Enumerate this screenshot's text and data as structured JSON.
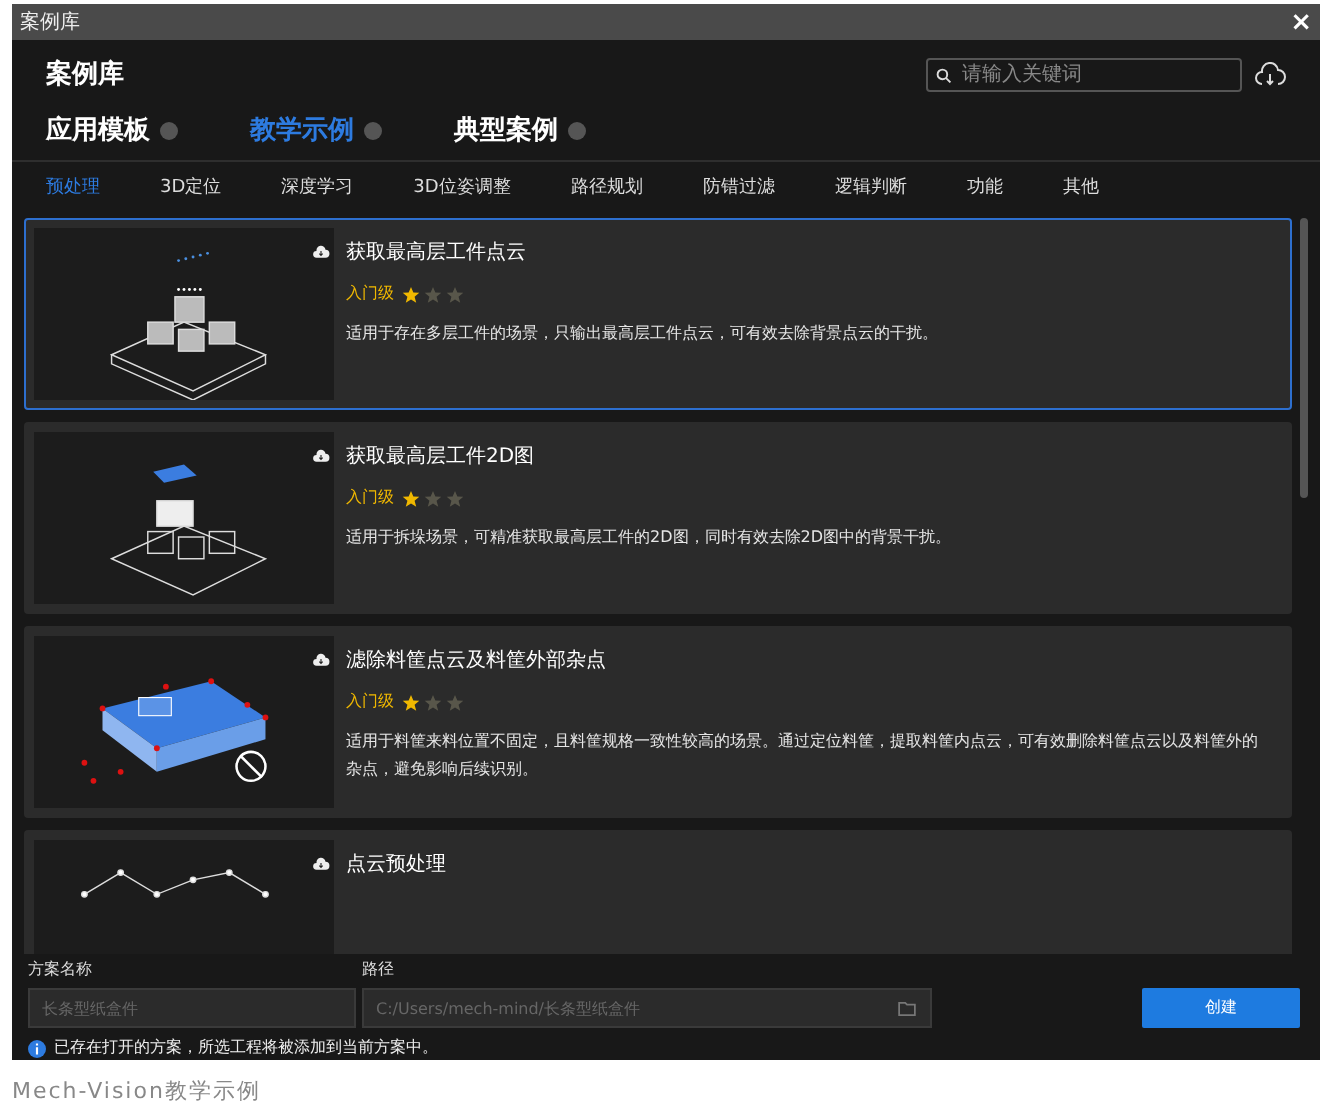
{
  "window": {
    "title": "案例库",
    "close": "×"
  },
  "header": {
    "title": "案例库",
    "search": {
      "placeholder": "请输入关键词"
    }
  },
  "tabs": [
    {
      "label": "应用模板",
      "selected": false
    },
    {
      "label": "教学示例",
      "selected": true
    },
    {
      "label": "典型案例",
      "selected": false
    }
  ],
  "categories": [
    {
      "label": "预处理",
      "selected": true
    },
    {
      "label": "3D定位",
      "selected": false
    },
    {
      "label": "深度学习",
      "selected": false
    },
    {
      "label": "3D位姿调整",
      "selected": false
    },
    {
      "label": "路径规划",
      "selected": false
    },
    {
      "label": "防错过滤",
      "selected": false
    },
    {
      "label": "逻辑判断",
      "selected": false
    },
    {
      "label": "功能",
      "selected": false
    },
    {
      "label": "其他",
      "selected": false
    }
  ],
  "cards": [
    {
      "kind": "points",
      "title": "获取最高层工件点云",
      "level_label": "入门级",
      "stars": 1,
      "description": "适用于存在多层工件的场景，只输出最高层工件点云，可有效去除背景点云的干扰。",
      "selected": true
    },
    {
      "kind": "image",
      "title": "获取最高层工件2D图",
      "level_label": "入门级",
      "stars": 1,
      "description": "适用于拆垛场景，可精准获取最高层工件的2D图，同时有效去除2D图中的背景干扰。",
      "selected": false
    },
    {
      "kind": "bin",
      "title": "滤除料筐点云及料筐外部杂点",
      "level_label": "入门级",
      "stars": 1,
      "description": "适用于料筐来料位置不固定，且料筐规格一致性较高的场景。通过定位料筐，提取料筐内点云，可有效删除料筐点云以及料筐外的杂点，避免影响后续识别。",
      "selected": false
    },
    {
      "kind": "mesh",
      "title": "点云预处理",
      "selected": false
    }
  ],
  "footer": {
    "name_label": "方案名称",
    "name_placeholder": "长条型纸盒件",
    "path_label": "路径",
    "path_placeholder": "C:/Users/mech-mind/长条型纸盒件",
    "create": "创建",
    "info": "已存在打开的方案，所选工程将被添加到当前方案中。"
  },
  "caption": "Mech-Vision教学示例"
}
